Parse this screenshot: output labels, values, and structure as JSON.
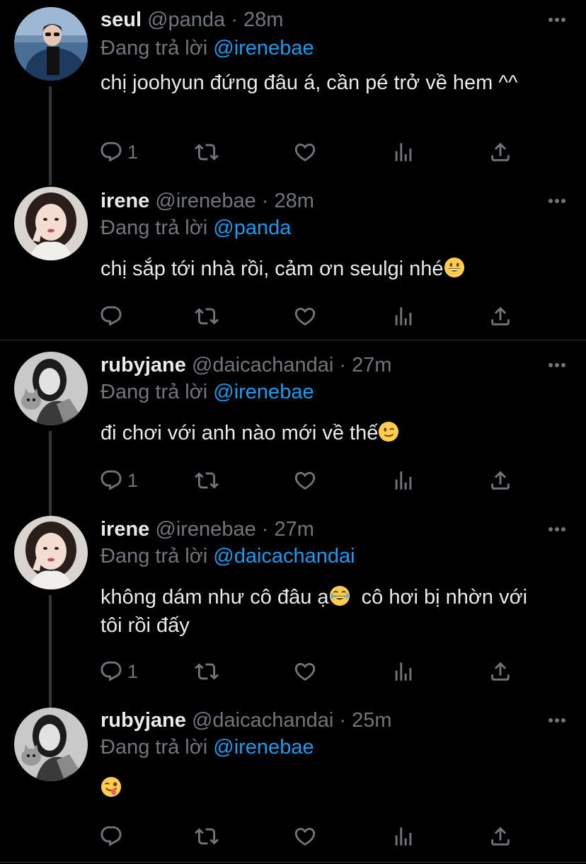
{
  "replying_label": "Đang trả lời",
  "tweets": [
    {
      "name": "seul",
      "handle": "@panda",
      "sep": "·",
      "time": "28m",
      "reply_to": "@irenebae",
      "text": "chị joohyun đứng đâu á, cần pé trở về hem ^^",
      "reply_count": "1"
    },
    {
      "name": "irene",
      "handle": "@irenebae",
      "sep": "·",
      "time": "28m",
      "reply_to": "@panda",
      "text": "chị sắp tới nhà rồi, cảm ơn seulgi nhé",
      "reply_count": ""
    },
    {
      "name": "rubyjane",
      "handle": "@daicachandai",
      "sep": "·",
      "time": "27m",
      "reply_to": "@irenebae",
      "text": "đi chơi với anh nào mới về thế",
      "reply_count": "1"
    },
    {
      "name": "irene",
      "handle": "@irenebae",
      "sep": "·",
      "time": "27m",
      "reply_to": "@daicachandai",
      "text_a": "không dám như cô đâu ạ",
      "text_b": "  cô hơi bị nhờn với tôi rồi đấy",
      "reply_count": "1"
    },
    {
      "name": "rubyjane",
      "handle": "@daicachandai",
      "sep": "·",
      "time": "25m",
      "reply_to": "@irenebae",
      "text": "",
      "reply_count": ""
    }
  ],
  "colors": {
    "background": "#000000",
    "text": "#e7e9ea",
    "secondary": "#71767b",
    "mention": "#1d9bf0",
    "divider": "#2f3336"
  },
  "icons": [
    "reply-icon",
    "retweet-icon",
    "like-icon",
    "analytics-icon",
    "share-icon",
    "more-icon",
    "grinning-emoji",
    "wink-emoji",
    "joy-emoji",
    "zany-emoji"
  ]
}
